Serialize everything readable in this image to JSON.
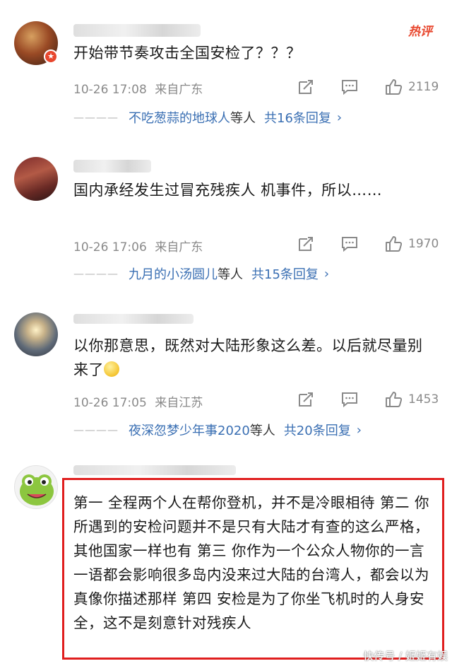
{
  "comments": [
    {
      "hot_label": "热评",
      "text": "开始带节奏攻击全国安检了？？？",
      "time": "10-26 17:08",
      "location": "来自广东",
      "likes": "2119",
      "reply_dash": "————",
      "reply_users": "不吃葱蒜的地球人",
      "reply_mid": "等人",
      "reply_count": "共16条回复",
      "reply_chevron": "›"
    },
    {
      "text": "国内承经发生过冒充残疾人 机事件，所以……",
      "time": "10-26 17:06",
      "location": "来自广东",
      "likes": "1970",
      "reply_dash": "————",
      "reply_users": "九月的小汤圆儿",
      "reply_mid": "等人",
      "reply_count": "共15条回复",
      "reply_chevron": "›"
    },
    {
      "text": "以你那意思，既然对大陆形象这么差。以后就尽量别来了",
      "time": "10-26 17:05",
      "location": "来自江苏",
      "likes": "1453",
      "reply_dash": "————",
      "reply_users": "夜深忽梦少年事2020",
      "reply_mid": "等人",
      "reply_count": "共20条回复",
      "reply_chevron": "›"
    },
    {
      "text": "第一 全程两个人在帮你登机，并不是冷眼相待 第二 你所遇到的安检问题并不是只有大陆才有查的这么严格，其他国家一样也有 第三 你作为一个公众人物你的一言一语都会影响很多岛内没来过大陆的台湾人，都会以为真像你描述那样 第四 安检是为了你坐飞机时的人身安全，这不是刻意针对残疾人"
    }
  ],
  "watermark": "快传号 / 姬姬有娱"
}
